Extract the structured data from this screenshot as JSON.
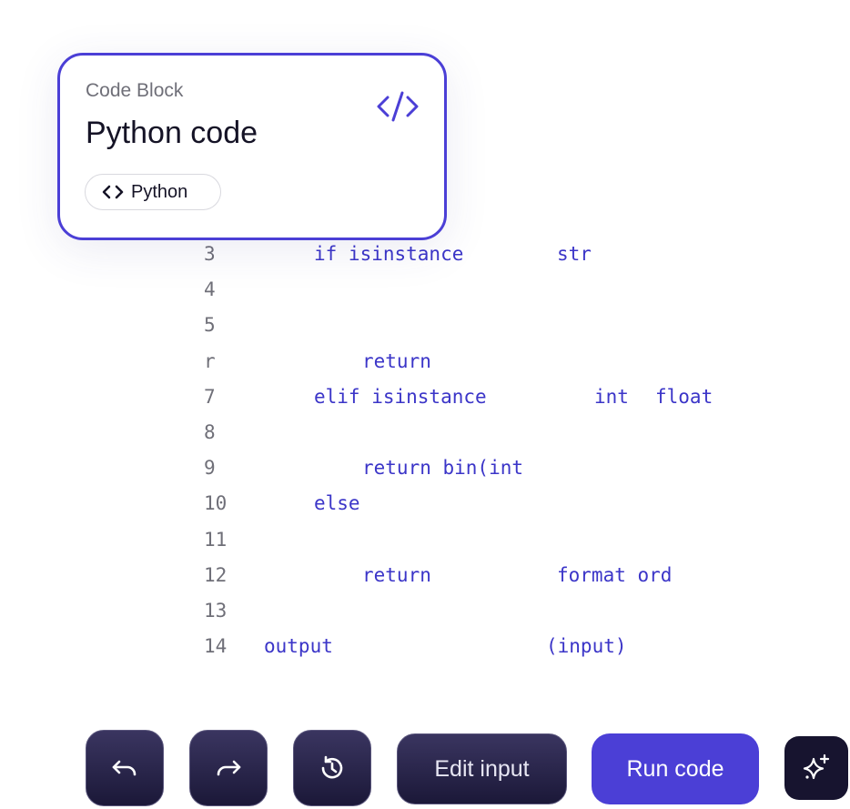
{
  "card": {
    "label": "Code Block",
    "title": "Python code",
    "icon": "code-icon",
    "language": "Python"
  },
  "code_lines": [
    {
      "num": "3",
      "tokens": [
        {
          "text": "if isinstance"
        },
        {
          "text": "str"
        }
      ]
    },
    {
      "num": "4",
      "tokens": []
    },
    {
      "num": "5",
      "tokens": []
    },
    {
      "num": "r",
      "tokens": [
        {
          "text": "return"
        }
      ]
    },
    {
      "num": "7",
      "tokens": [
        {
          "text": "elif isinstance"
        },
        {
          "text": "int"
        },
        {
          "text": "float"
        }
      ]
    },
    {
      "num": "8",
      "tokens": []
    },
    {
      "num": "9",
      "tokens": [
        {
          "text": "return bin(int"
        }
      ]
    },
    {
      "num": "10",
      "tokens": [
        {
          "text": "else"
        }
      ]
    },
    {
      "num": "11",
      "tokens": []
    },
    {
      "num": "12",
      "tokens": [
        {
          "text": "return"
        },
        {
          "text": "format ord"
        }
      ]
    },
    {
      "num": "13",
      "tokens": []
    },
    {
      "num": "14",
      "tokens": [
        {
          "text": "output"
        },
        {
          "text": "(input)"
        }
      ]
    }
  ],
  "toolbar": {
    "undo_icon": "undo-icon",
    "redo_icon": "redo-icon",
    "history_icon": "history-icon",
    "edit_label": "Edit input",
    "run_label": "Run code",
    "ai_icon": "sparkle-icon"
  },
  "colors": {
    "accent": "#4b3fd6",
    "code_token": "#3b35c8",
    "line_number": "#6f6f78",
    "dark_button": "#1b1838"
  }
}
